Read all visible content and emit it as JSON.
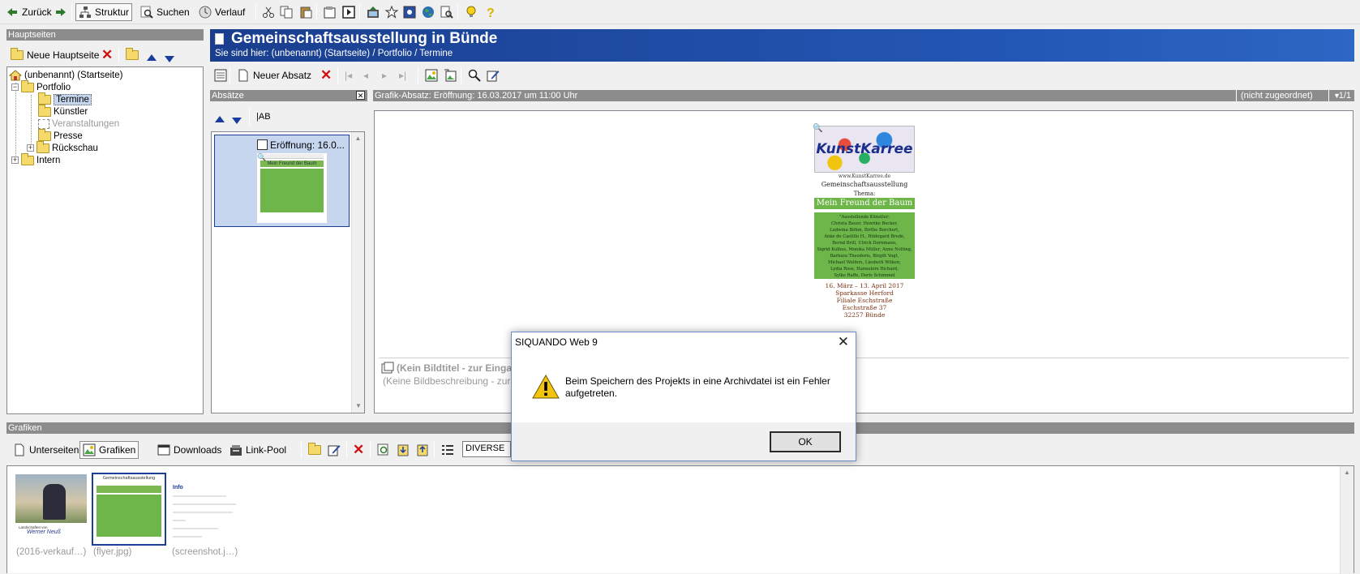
{
  "toolbar": {
    "back_label": "Zurück",
    "structure_label": "Struktur",
    "search_label": "Suchen",
    "history_label": "Verlauf"
  },
  "sidebar": {
    "header": "Hauptseiten",
    "new_page_label": "Neue Hauptseite",
    "tree": [
      {
        "label": "(unbenannt) (Startseite)",
        "icon": "home-icon"
      },
      {
        "label": "Portfolio",
        "icon": "folder-icon"
      },
      {
        "label": "Termine",
        "icon": "folder-icon",
        "selected": true
      },
      {
        "label": "Künstler",
        "icon": "folder-icon"
      },
      {
        "label": "Veranstaltungen",
        "icon": "empty-folder-icon",
        "disabled": true
      },
      {
        "label": "Presse",
        "icon": "folder-icon"
      },
      {
        "label": "Rückschau",
        "icon": "folder-icon"
      },
      {
        "label": "Intern",
        "icon": "folder-icon"
      }
    ]
  },
  "page_header": {
    "title": "Gemeinschaftsausstellung in Bünde",
    "breadcrumb": "Sie sind hier: (unbenannt) (Startseite) / Portfolio / Termine"
  },
  "editor_toolbar": {
    "new_paragraph_label": "Neuer Absatz"
  },
  "paragraphs_panel": {
    "header": "Absätze",
    "item_label": "Eröffnung: 16.0...",
    "thumb_heading": "Mein Freund der Baum"
  },
  "content_panel": {
    "header": "Grafik-Absatz: Eröffnung: 16.03.2017 um 11:00 Uhr",
    "assignment": "(nicht zugeordnet)",
    "page_count": "1/1",
    "no_title": "(Kein Bildtitel - zur Eingab",
    "no_description": "(Keine Bildbeschreibung - zur Eing"
  },
  "flyer": {
    "logo_text": "KunstKarree",
    "url": "www.KunstKarree.de",
    "headline": "Gemeinschaftsausstellung",
    "theme_label": "Thema:",
    "theme": "Mein Freund der Baum",
    "dates": "16. März – 13. April 2017",
    "venue_1": "Sparkasse Herford",
    "venue_2": "Filiale Eschstraße",
    "venue_3": "Eschstraße 37",
    "venue_4": "32257 Bünde",
    "artists": [
      "\"Ausstellende Künstler:",
      "Christa Bauer, Henrike Becker,",
      "Ludwina Böhm, Birthe Borchert,",
      "Anke de Castillo H., Hildegard Brede,",
      "Bernd Brill, Ulrich Dornmann,",
      "Sigrid Kulhus, Monika Müller, Anne Nolting,",
      "Barbara Theodoris, Birgitt Vogt,",
      "Michael Wolfers, Liesbeth Wilken,",
      "Lydia Rose, Hannelore Richard,",
      "Sylke Raffe, Doris Schimmel"
    ]
  },
  "dialog": {
    "title": "SIQUANDO Web 9",
    "message": "Beim Speichern des Projekts in eine Archivdatei ist ein Fehler aufgetreten.",
    "ok_label": "OK"
  },
  "graphics_panel": {
    "header": "Grafiken",
    "tab_subpages": "Unterseiten",
    "tab_graphics": "Grafiken",
    "tab_downloads": "Downloads",
    "tab_linkpool": "Link-Pool",
    "filter_value": "DIVERSE",
    "thumbnails": [
      {
        "label": "(2016-verkauf…)"
      },
      {
        "label": "(flyer.jpg)"
      },
      {
        "label": "(screenshot.j…)"
      }
    ],
    "thumb1_caption": "Landschaften von",
    "thumb1_signature": "Werner Neuß",
    "thumb2_heading": "Gemeinschaftsausstellung",
    "thumb3_title": "Info"
  },
  "colors": {
    "header_blue": "#1f4fa8",
    "panel_gray": "#8c8c8c",
    "selection_blue": "#c5d6ee",
    "flyer_green": "#6fb64a"
  }
}
